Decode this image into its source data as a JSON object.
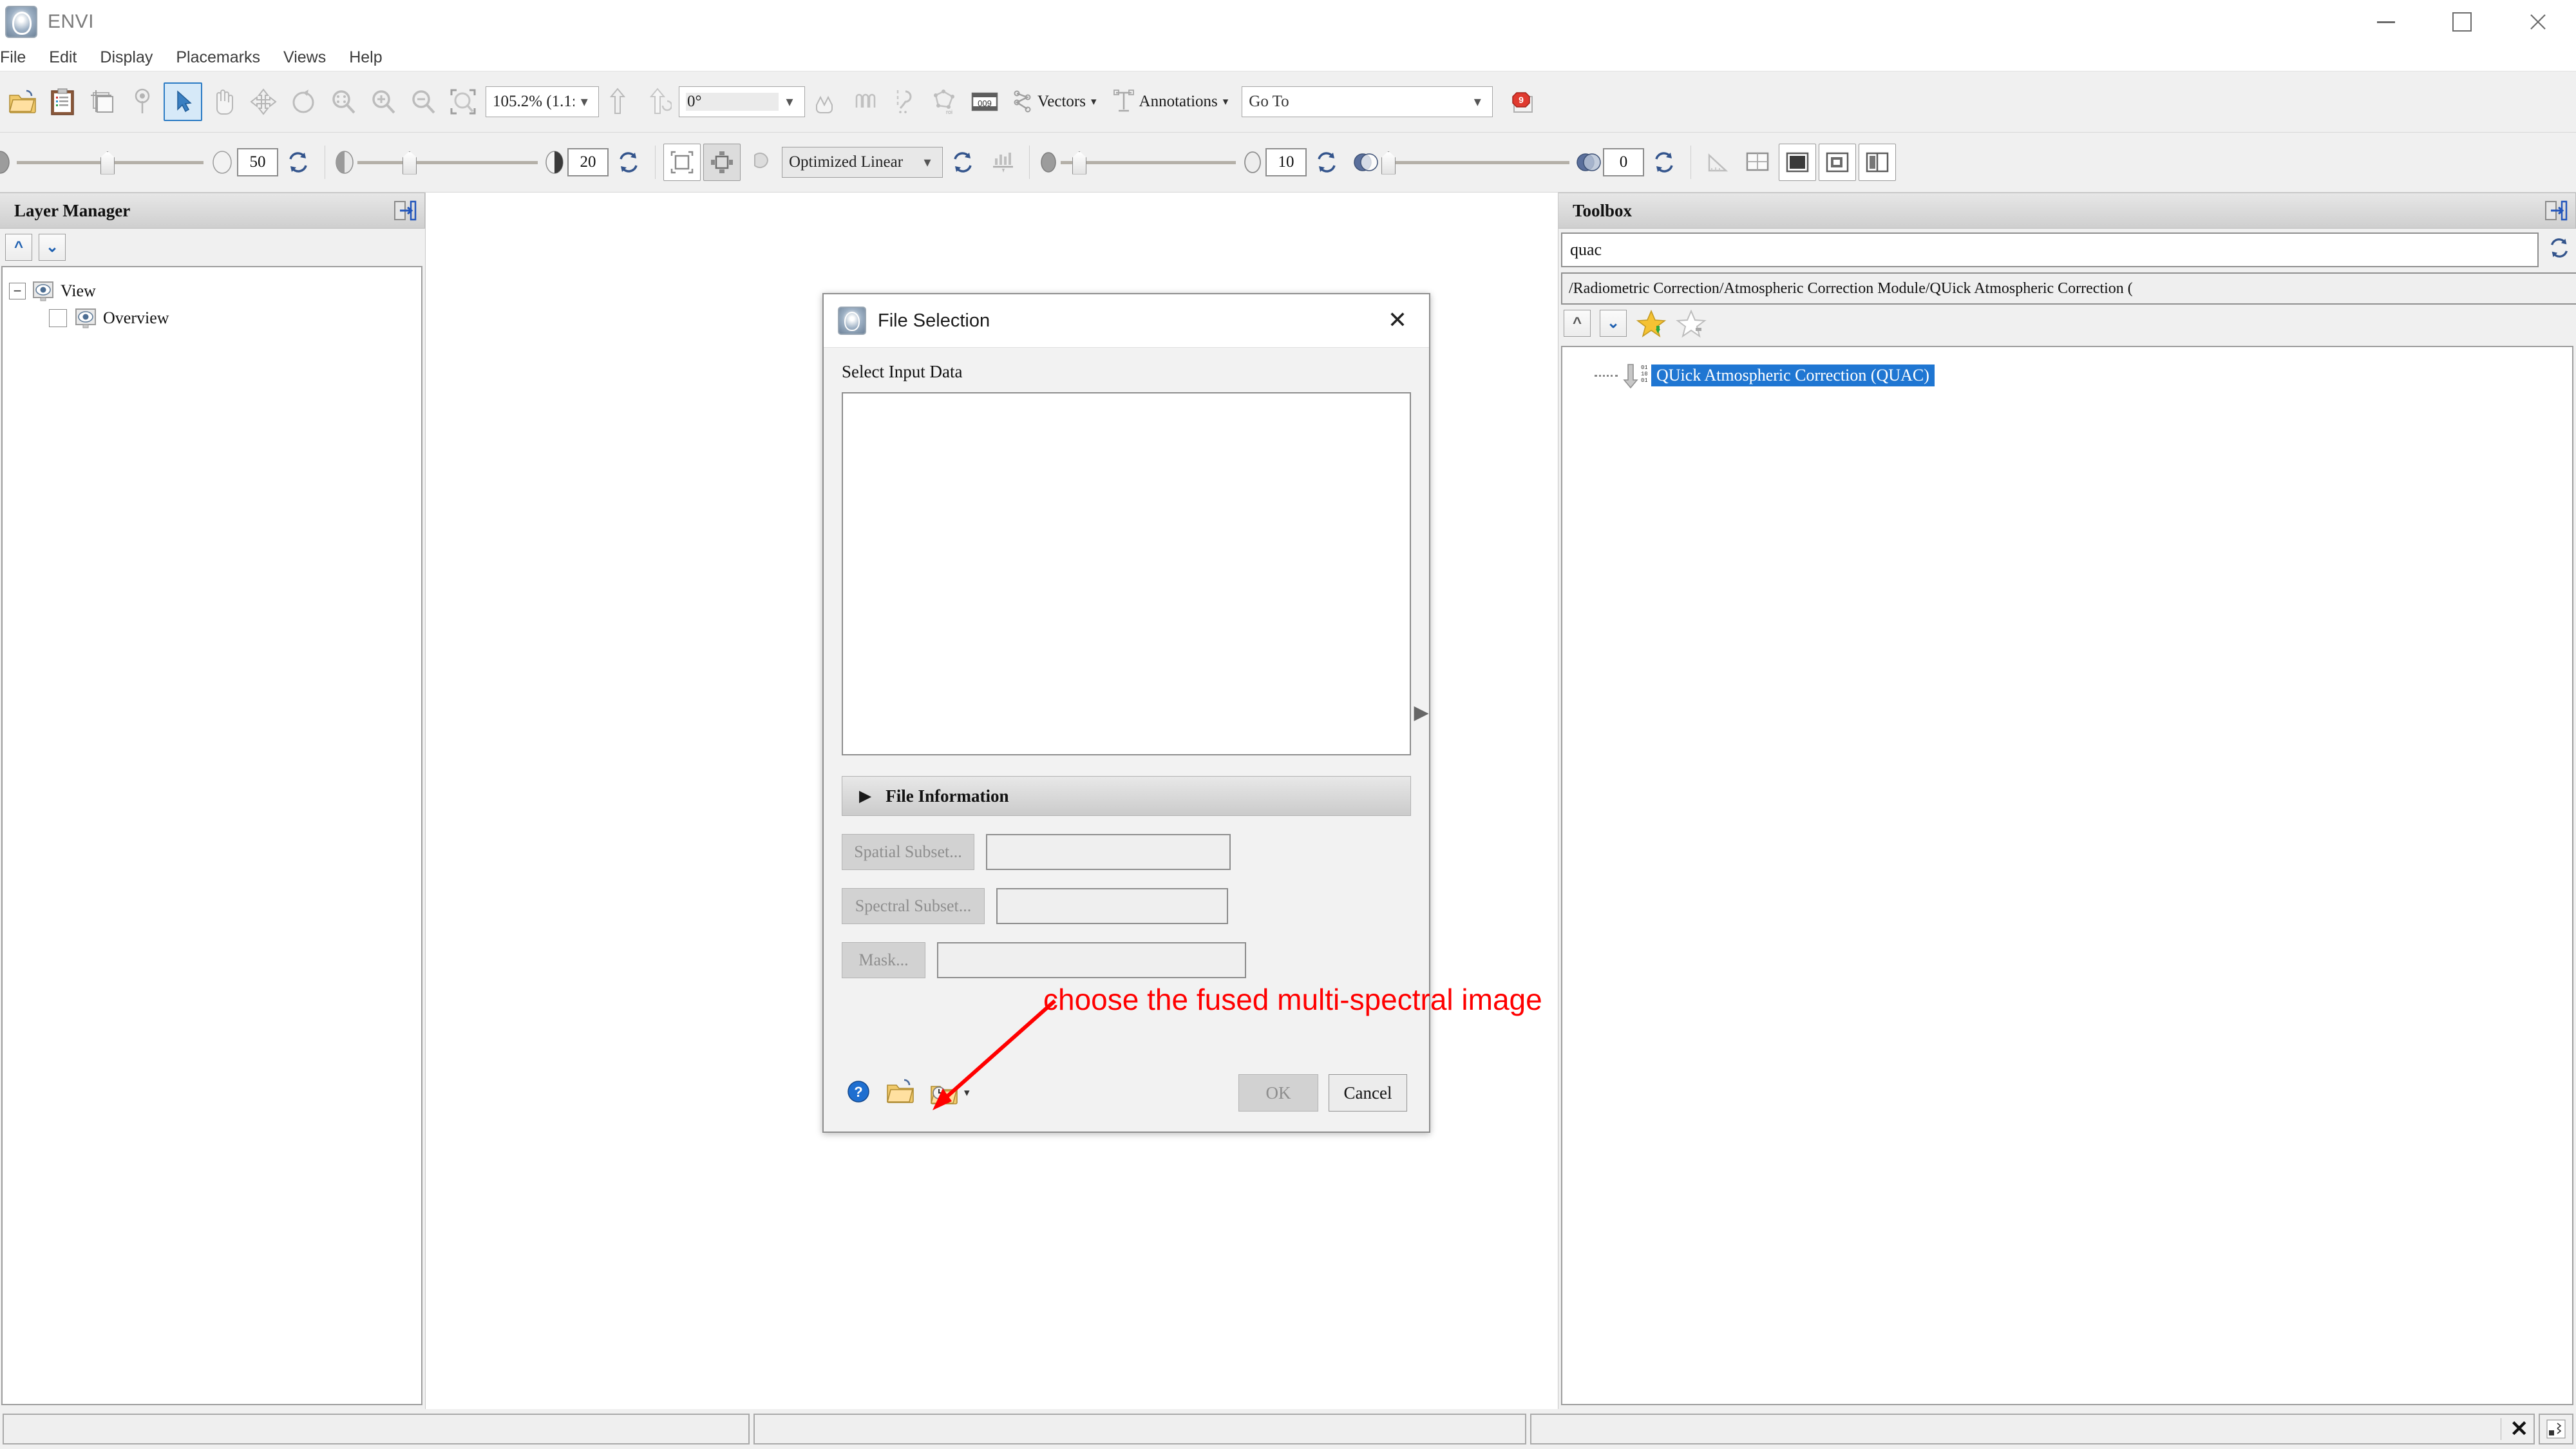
{
  "window": {
    "app_title": "ENVI",
    "app_icon": "envi-logo-icon",
    "minimize": "—",
    "maximize": "☐",
    "close": "✕"
  },
  "menubar": {
    "items": [
      {
        "label": "File"
      },
      {
        "label": "Edit"
      },
      {
        "label": "Display"
      },
      {
        "label": "Placemarks"
      },
      {
        "label": "Views"
      },
      {
        "label": "Help"
      }
    ]
  },
  "toolbar1": {
    "zoom_value": "105.2% (1.1::",
    "rotation_value": "0°",
    "vectors_label": "Vectors",
    "annotations_label": "Annotations",
    "goto_value": "Go To",
    "caret": "▾"
  },
  "toolbar2": {
    "brightness_value": "50",
    "contrast_value": "20",
    "stretch_value": "Optimized Linear",
    "sharpen_value": "10",
    "transparency_value": "0"
  },
  "layer_manager": {
    "title": "Layer Manager",
    "tree": [
      {
        "label": "View",
        "expander": "−",
        "level": 0
      },
      {
        "label": "Overview",
        "level": 1,
        "checked": false
      }
    ]
  },
  "toolbox": {
    "title": "Toolbox",
    "search_value": "quac",
    "path": "/Radiometric Correction/Atmospheric Correction Module/QUick Atmospheric Correction (",
    "selected_item": "QUick Atmospheric Correction (QUAC)"
  },
  "dialog": {
    "title": "File Selection",
    "close": "✕",
    "select_input_label": "Select Input Data",
    "file_information_label": "File Information",
    "file_information_triangle": "▶",
    "spatial_subset_label": "Spatial Subset...",
    "spectral_subset_label": "Spectral Subset...",
    "mask_label": "Mask...",
    "spatial_subset_value": "",
    "spectral_subset_value": "",
    "mask_value": "",
    "ok_label": "OK",
    "cancel_label": "Cancel",
    "expander_triangle": "▶"
  },
  "annotation": {
    "text": "choose the fused multi-spectral image",
    "color": "#ff0000"
  },
  "statusbar": {
    "field1": "",
    "field2": "",
    "field3": "",
    "close_glyph": "✕"
  },
  "colors": {
    "accent_blue": "#1f76d2",
    "selection_blue": "#1f76d2",
    "toolbar_bg": "#f0f0f0",
    "annotation_red": "#ff0000"
  }
}
